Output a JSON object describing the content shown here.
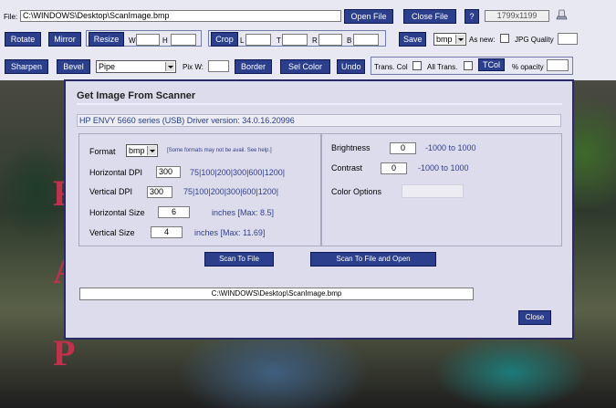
{
  "toolbar": {
    "file_label": "File:",
    "file_path": "C:\\WINDOWS\\Desktop\\ScanImage.bmp",
    "open_file": "Open File",
    "close_file": "Close File",
    "help": "?",
    "dimensions": "1799x1199",
    "rotate": "Rotate",
    "mirror": "Mirror",
    "resize": "Resize",
    "w_label": "W",
    "h_label": "H",
    "crop": "Crop",
    "l_label": "L",
    "t_label": "T",
    "r_label": "R",
    "b_label": "B",
    "save": "Save",
    "format": "bmp",
    "as_new": "As new:",
    "jpg_quality": "JPG Quality",
    "sharpen": "Sharpen",
    "bevel": "Bevel",
    "effect": "Pipe",
    "pix_w": "Pix W:",
    "border": "Border",
    "sel_color": "Sel Color",
    "undo": "Undo",
    "trans_col": "Trans. Col",
    "all_trans": "All Trans.",
    "tcol": "TCol",
    "pct_opacity": "% opacity"
  },
  "background": {
    "letters": [
      "F",
      "A",
      "P"
    ]
  },
  "dialog": {
    "title": "Get Image From Scanner",
    "driver": "HP ENVY 5660 series (USB) Driver version: 34.0.16.20996",
    "format_label": "Format",
    "format_value": "bmp",
    "format_note": "[Some formats may not be avail. See help.]",
    "hdpi_label": "Horizontal DPI",
    "hdpi_value": "300",
    "hdpi_options": "75|100|200|300|600|1200|",
    "vdpi_label": "Vertical DPI",
    "vdpi_value": "300",
    "vdpi_options": "75|100|200|300|600|1200|",
    "hsize_label": "Horizontal Size",
    "hsize_value": "6",
    "hsize_note": "inches [Max: 8.5]",
    "vsize_label": "Vertical Size",
    "vsize_value": "4",
    "vsize_note": "inches [Max: 11.69]",
    "brightness_label": "Brightness",
    "brightness_value": "0",
    "brightness_range": "-1000 to 1000",
    "contrast_label": "Contrast",
    "contrast_value": "0",
    "contrast_range": "-1000 to 1000",
    "color_options_label": "Color Options",
    "scan_to_file": "Scan To File",
    "scan_to_file_open": "Scan To File and Open",
    "output_path": "C:\\WINDOWS\\Desktop\\ScanImage.bmp",
    "close": "Close"
  },
  "colors": {
    "accent": "#2b3f8c",
    "dialog_bg": "#dcdcec",
    "label_blue": "#33418a"
  }
}
